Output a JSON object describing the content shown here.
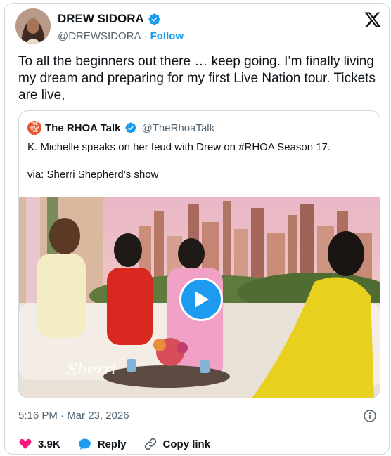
{
  "author": {
    "name": "DREW SIDORA",
    "handle": "@DREWSIDORA",
    "separator": "·",
    "follow_label": "Follow",
    "verified_color": "#1d9bf0"
  },
  "tweet": {
    "text": "To all the beginners out there … keep going. I’m finally living my dream and preparing for my first Live Nation tour. Tickets are live,",
    "timestamp": "5:16 PM · Mar 23, 2026"
  },
  "quote": {
    "avatar_text": "THE RHOA Talk",
    "name": "The RHOA Talk",
    "handle": "@TheRhoaTalk",
    "text": "K. Michelle speaks on her feud with Drew on #RHOA Season 17.",
    "via": "via: Sherri Shepherd’s show",
    "video_watermark": "Sherri"
  },
  "actions": {
    "likes": "3.9K",
    "reply_label": "Reply",
    "copy_label": "Copy link"
  },
  "colors": {
    "accent": "#1d9bf0",
    "like": "#f91880",
    "secondary_text": "#536471"
  }
}
